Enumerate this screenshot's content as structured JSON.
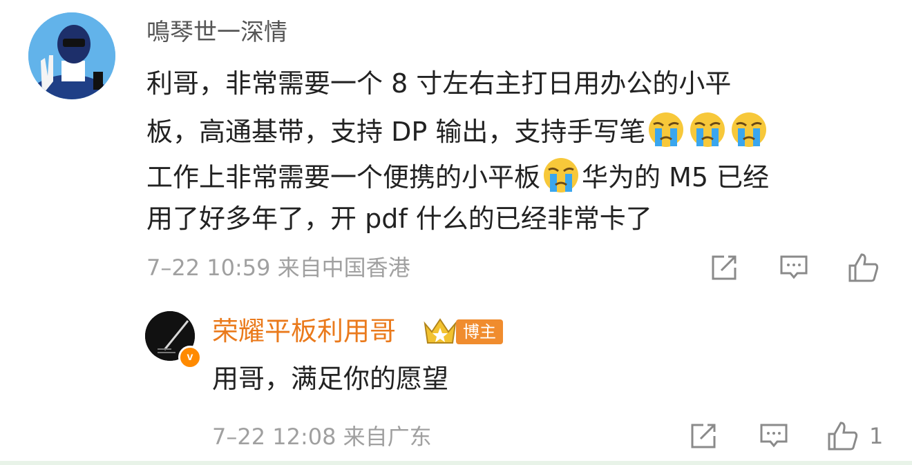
{
  "comment": {
    "username": "鳴琴世一深情",
    "lines": [
      "利哥，非常需要一个 8 寸左右主打日用办公的小平",
      "板，高通基带，支持 DP 输出，支持手写笔",
      "工作上非常需要一个便携的小平板",
      "华为的 M5 已经",
      "用了好多年了，开 pdf 什么的已经非常卡了"
    ],
    "emoji_name": "crying-face-icon",
    "time": "7–22 10:59",
    "source": "来自中国香港"
  },
  "reply": {
    "username": "荣耀平板利用哥",
    "badge": "博主",
    "verified_mark": "v",
    "text": "用哥，满足你的愿望",
    "time": "7–22 12:08",
    "source": "来自广东",
    "like_count": "1"
  },
  "colors": {
    "reply_username": "#ea7a1c",
    "badge_bg": "#f08c2e",
    "meta_text": "#a0a0a0",
    "body_text": "#222222"
  }
}
